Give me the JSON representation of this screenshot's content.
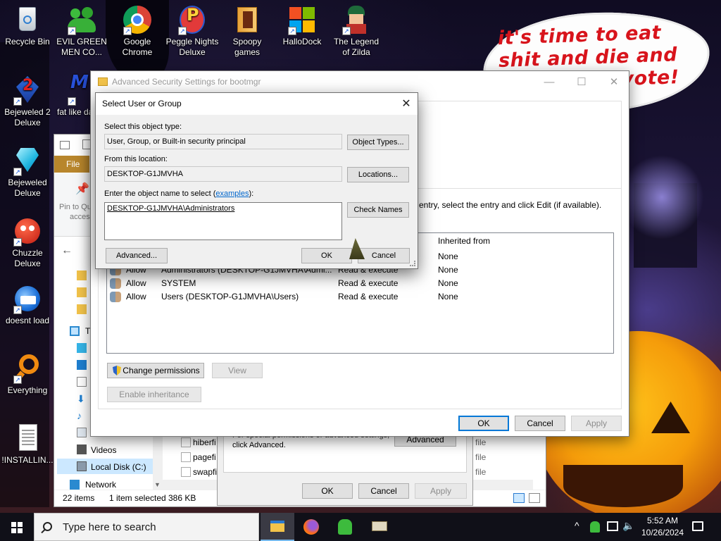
{
  "desktop": {
    "meme_text": "it's time to eat shit and die and go trick or vote!",
    "icons": [
      {
        "label": "Recycle Bin"
      },
      {
        "label": "EVIL GREEN MEN CO..."
      },
      {
        "label": "Google Chrome"
      },
      {
        "label": "Peggle Nights Deluxe"
      },
      {
        "label": "Spoopy games"
      },
      {
        "label": "HalloDock"
      },
      {
        "label": "The Legend of Zilda"
      },
      {
        "label": "Bejeweled 2 Deluxe"
      },
      {
        "label": "fat like da"
      },
      {
        "label": "Bejeweled Deluxe"
      },
      {
        "label": "Chuzzle Deluxe"
      },
      {
        "label": "doesnt load"
      },
      {
        "label": "Everything"
      },
      {
        "label": "!INSTALLIN..."
      }
    ]
  },
  "explorer": {
    "file_tab": "File",
    "pin_label": "Pin to Qu",
    "pin_label2": "access",
    "nav_this_pc": "Th",
    "nav_videos": "Videos",
    "nav_local_disk": "Local Disk (C:)",
    "nav_network": "Network",
    "files": [
      "hiberfi",
      "pagefi",
      "swapfi"
    ],
    "file_types": [
      "file",
      "file",
      "file"
    ],
    "status_items": "22 items",
    "status_selected": "1 item selected",
    "status_size": "386 KB"
  },
  "perm_dialog": {
    "text1": "For special permissions or advanced settings,",
    "text2": "click Advanced.",
    "advanced": "Advanced",
    "ok": "OK",
    "cancel": "Cancel",
    "apply": "Apply"
  },
  "adv_security": {
    "title": "Advanced Security Settings for bootmgr",
    "instruction": "entry, select the entry and click Edit (if available).",
    "col_inherited": "Inherited from",
    "rows": [
      {
        "type": "",
        "principal": "",
        "access": "",
        "inherited": "None"
      },
      {
        "type": "Allow",
        "principal": "Administrators (DESKTOP-G1JMVHA\\Admi...",
        "access": "Read & execute",
        "inherited": "None"
      },
      {
        "type": "Allow",
        "principal": "SYSTEM",
        "access": "Read & execute",
        "inherited": "None"
      },
      {
        "type": "Allow",
        "principal": "Users (DESKTOP-G1JMVHA\\Users)",
        "access": "Read & execute",
        "inherited": "None"
      }
    ],
    "change_permissions": "Change permissions",
    "view": "View",
    "enable_inheritance": "Enable inheritance",
    "ok": "OK",
    "cancel": "Cancel",
    "apply": "Apply"
  },
  "select_user": {
    "title": "Select User or Group",
    "object_type_label": "Select this object type:",
    "object_type_value": "User, Group, or Built-in security principal",
    "object_types_btn": "Object Types...",
    "location_label": "From this location:",
    "location_value": "DESKTOP-G1JMVHA",
    "locations_btn": "Locations...",
    "enter_label": "Enter the object name to select (",
    "examples_link": "examples",
    "enter_label_end": "):",
    "object_name": "DESKTOP-G1JMVHA\\Administrators",
    "check_names_btn": "Check Names",
    "advanced_btn": "Advanced...",
    "ok_btn": "OK",
    "cancel_btn": "Cancel"
  },
  "taskbar": {
    "search_placeholder": "Type here to search",
    "time": "5:52 AM",
    "date": "10/26/2024"
  },
  "colors": {
    "accent": "#0078d7",
    "meme_red": "#d8141c",
    "file_tab": "#b8862c"
  }
}
